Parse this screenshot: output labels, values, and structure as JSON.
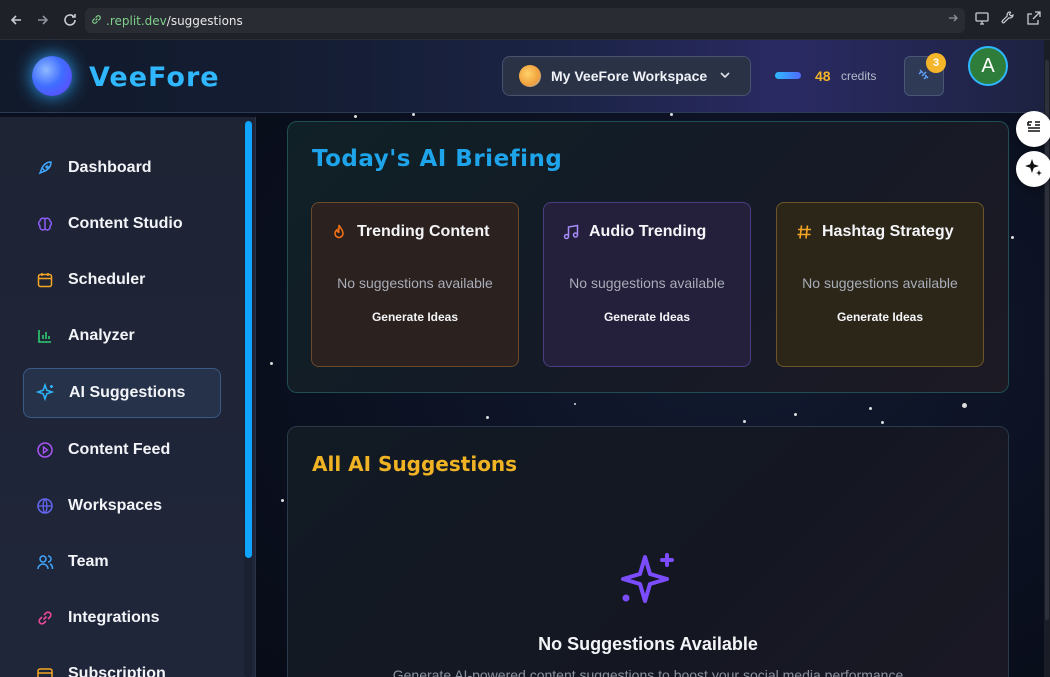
{
  "browser": {
    "url_domain": ".replit.dev",
    "url_path": "/suggestions"
  },
  "header": {
    "brand": "VeeFore",
    "workspace": "My VeeFore Workspace",
    "credits_value": "48",
    "credits_label": "credits",
    "notification_count": "3",
    "user_initial": "A"
  },
  "sidebar": {
    "items": [
      {
        "label": "Dashboard",
        "icon": "rocket-icon"
      },
      {
        "label": "Content Studio",
        "icon": "brain-icon"
      },
      {
        "label": "Scheduler",
        "icon": "calendar-icon"
      },
      {
        "label": "Analyzer",
        "icon": "bar-chart-icon"
      },
      {
        "label": "AI Suggestions",
        "icon": "sparkles-icon",
        "active": true
      },
      {
        "label": "Content Feed",
        "icon": "play-circle-icon"
      },
      {
        "label": "Workspaces",
        "icon": "globe-icon"
      },
      {
        "label": "Team",
        "icon": "users-icon"
      },
      {
        "label": "Integrations",
        "icon": "link-icon"
      },
      {
        "label": "Subscription",
        "icon": "card-icon"
      }
    ]
  },
  "briefing": {
    "title": "Today's AI Briefing",
    "cards": [
      {
        "title": "Trending Content",
        "empty": "No suggestions available",
        "action": "Generate Ideas"
      },
      {
        "title": "Audio Trending",
        "empty": "No suggestions available",
        "action": "Generate Ideas"
      },
      {
        "title": "Hashtag Strategy",
        "empty": "No suggestions available",
        "action": "Generate Ideas"
      }
    ]
  },
  "all_suggestions": {
    "title": "All AI Suggestions",
    "empty_title": "No Suggestions Available",
    "empty_desc": "Generate AI-powered content suggestions to boost your social media performance"
  },
  "colors": {
    "accent_blue": "#1ea4ea",
    "accent_gold": "#f0b323",
    "accent_purple": "#7c4dff"
  }
}
